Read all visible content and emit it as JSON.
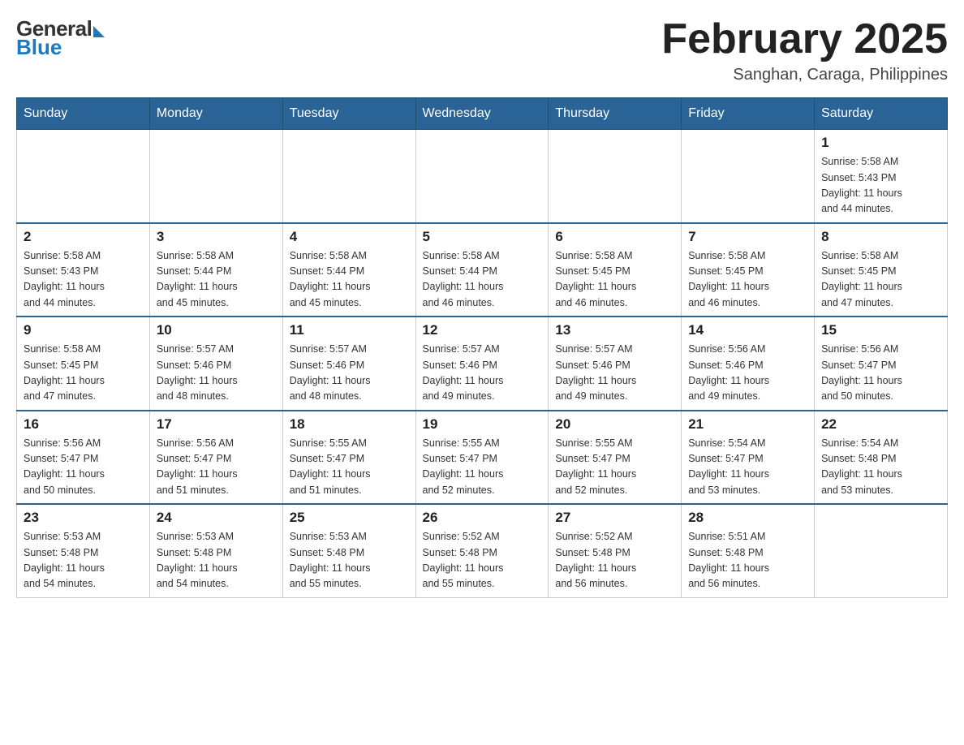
{
  "header": {
    "logo_general": "General",
    "logo_blue": "Blue",
    "month_title": "February 2025",
    "location": "Sanghan, Caraga, Philippines"
  },
  "days_of_week": [
    "Sunday",
    "Monday",
    "Tuesday",
    "Wednesday",
    "Thursday",
    "Friday",
    "Saturday"
  ],
  "weeks": [
    [
      {
        "day": "",
        "info": ""
      },
      {
        "day": "",
        "info": ""
      },
      {
        "day": "",
        "info": ""
      },
      {
        "day": "",
        "info": ""
      },
      {
        "day": "",
        "info": ""
      },
      {
        "day": "",
        "info": ""
      },
      {
        "day": "1",
        "info": "Sunrise: 5:58 AM\nSunset: 5:43 PM\nDaylight: 11 hours\nand 44 minutes."
      }
    ],
    [
      {
        "day": "2",
        "info": "Sunrise: 5:58 AM\nSunset: 5:43 PM\nDaylight: 11 hours\nand 44 minutes."
      },
      {
        "day": "3",
        "info": "Sunrise: 5:58 AM\nSunset: 5:44 PM\nDaylight: 11 hours\nand 45 minutes."
      },
      {
        "day": "4",
        "info": "Sunrise: 5:58 AM\nSunset: 5:44 PM\nDaylight: 11 hours\nand 45 minutes."
      },
      {
        "day": "5",
        "info": "Sunrise: 5:58 AM\nSunset: 5:44 PM\nDaylight: 11 hours\nand 46 minutes."
      },
      {
        "day": "6",
        "info": "Sunrise: 5:58 AM\nSunset: 5:45 PM\nDaylight: 11 hours\nand 46 minutes."
      },
      {
        "day": "7",
        "info": "Sunrise: 5:58 AM\nSunset: 5:45 PM\nDaylight: 11 hours\nand 46 minutes."
      },
      {
        "day": "8",
        "info": "Sunrise: 5:58 AM\nSunset: 5:45 PM\nDaylight: 11 hours\nand 47 minutes."
      }
    ],
    [
      {
        "day": "9",
        "info": "Sunrise: 5:58 AM\nSunset: 5:45 PM\nDaylight: 11 hours\nand 47 minutes."
      },
      {
        "day": "10",
        "info": "Sunrise: 5:57 AM\nSunset: 5:46 PM\nDaylight: 11 hours\nand 48 minutes."
      },
      {
        "day": "11",
        "info": "Sunrise: 5:57 AM\nSunset: 5:46 PM\nDaylight: 11 hours\nand 48 minutes."
      },
      {
        "day": "12",
        "info": "Sunrise: 5:57 AM\nSunset: 5:46 PM\nDaylight: 11 hours\nand 49 minutes."
      },
      {
        "day": "13",
        "info": "Sunrise: 5:57 AM\nSunset: 5:46 PM\nDaylight: 11 hours\nand 49 minutes."
      },
      {
        "day": "14",
        "info": "Sunrise: 5:56 AM\nSunset: 5:46 PM\nDaylight: 11 hours\nand 49 minutes."
      },
      {
        "day": "15",
        "info": "Sunrise: 5:56 AM\nSunset: 5:47 PM\nDaylight: 11 hours\nand 50 minutes."
      }
    ],
    [
      {
        "day": "16",
        "info": "Sunrise: 5:56 AM\nSunset: 5:47 PM\nDaylight: 11 hours\nand 50 minutes."
      },
      {
        "day": "17",
        "info": "Sunrise: 5:56 AM\nSunset: 5:47 PM\nDaylight: 11 hours\nand 51 minutes."
      },
      {
        "day": "18",
        "info": "Sunrise: 5:55 AM\nSunset: 5:47 PM\nDaylight: 11 hours\nand 51 minutes."
      },
      {
        "day": "19",
        "info": "Sunrise: 5:55 AM\nSunset: 5:47 PM\nDaylight: 11 hours\nand 52 minutes."
      },
      {
        "day": "20",
        "info": "Sunrise: 5:55 AM\nSunset: 5:47 PM\nDaylight: 11 hours\nand 52 minutes."
      },
      {
        "day": "21",
        "info": "Sunrise: 5:54 AM\nSunset: 5:47 PM\nDaylight: 11 hours\nand 53 minutes."
      },
      {
        "day": "22",
        "info": "Sunrise: 5:54 AM\nSunset: 5:48 PM\nDaylight: 11 hours\nand 53 minutes."
      }
    ],
    [
      {
        "day": "23",
        "info": "Sunrise: 5:53 AM\nSunset: 5:48 PM\nDaylight: 11 hours\nand 54 minutes."
      },
      {
        "day": "24",
        "info": "Sunrise: 5:53 AM\nSunset: 5:48 PM\nDaylight: 11 hours\nand 54 minutes."
      },
      {
        "day": "25",
        "info": "Sunrise: 5:53 AM\nSunset: 5:48 PM\nDaylight: 11 hours\nand 55 minutes."
      },
      {
        "day": "26",
        "info": "Sunrise: 5:52 AM\nSunset: 5:48 PM\nDaylight: 11 hours\nand 55 minutes."
      },
      {
        "day": "27",
        "info": "Sunrise: 5:52 AM\nSunset: 5:48 PM\nDaylight: 11 hours\nand 56 minutes."
      },
      {
        "day": "28",
        "info": "Sunrise: 5:51 AM\nSunset: 5:48 PM\nDaylight: 11 hours\nand 56 minutes."
      },
      {
        "day": "",
        "info": ""
      }
    ]
  ]
}
